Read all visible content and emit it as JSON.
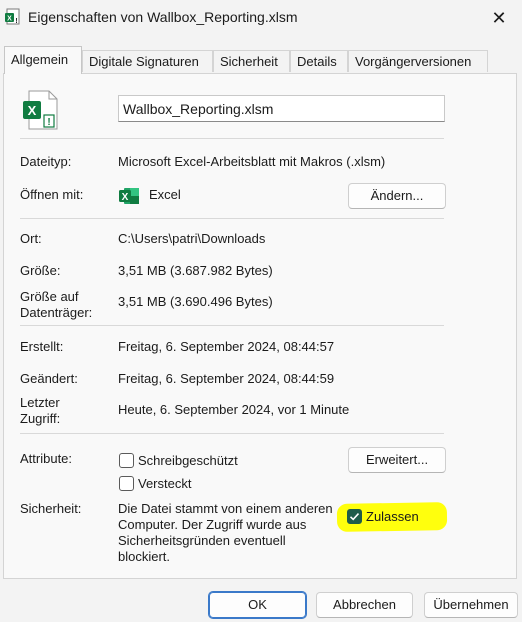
{
  "window": {
    "title": "Eigenschaften von Wallbox_Reporting.xlsm",
    "close_glyph": "✕"
  },
  "tabs": [
    {
      "label": "Allgemein",
      "active": true
    },
    {
      "label": "Digitale Signaturen",
      "active": false
    },
    {
      "label": "Sicherheit",
      "active": false
    },
    {
      "label": "Details",
      "active": false
    },
    {
      "label": "Vorgängerversionen",
      "active": false
    }
  ],
  "general": {
    "file_name": "Wallbox_Reporting.xlsm",
    "file_type_label": "Dateityp:",
    "file_type_value": "Microsoft Excel-Arbeitsblatt mit Makros (.xlsm)",
    "open_with_label": "Öffnen mit:",
    "open_with_value": "Excel",
    "change_button": "Ändern...",
    "location_label": "Ort:",
    "location_value": "C:\\Users\\patri\\Downloads",
    "size_label": "Größe:",
    "size_value": "3,51 MB (3.687.982 Bytes)",
    "size_on_disk_label": "Größe auf Datenträger:",
    "size_on_disk_value": "3,51 MB (3.690.496 Bytes)",
    "created_label": "Erstellt:",
    "created_value": "Freitag, 6. September 2024, 08:44:57",
    "modified_label": "Geändert:",
    "modified_value": "Freitag, 6. September 2024, 08:44:59",
    "accessed_label": "Letzter Zugriff:",
    "accessed_value": "Heute, 6. September 2024, vor 1 Minute",
    "attributes_label": "Attribute:",
    "readonly_label": "Schreibgeschützt",
    "readonly_checked": false,
    "hidden_label": "Versteckt",
    "hidden_checked": false,
    "advanced_button": "Erweitert...",
    "security_label": "Sicherheit:",
    "security_text": "Die Datei stammt von einem anderen Computer. Der Zugriff wurde aus Sicherheitsgründen eventuell blockiert.",
    "unblock_label": "Zulassen",
    "unblock_checked": true
  },
  "footer": {
    "ok": "OK",
    "cancel": "Abbrechen",
    "apply": "Übernehmen"
  },
  "colors": {
    "excel_green": "#107c41",
    "highlight": "#ffff00",
    "checkbox_checked": "#1f5c4a",
    "primary_border": "#3a79c9"
  }
}
